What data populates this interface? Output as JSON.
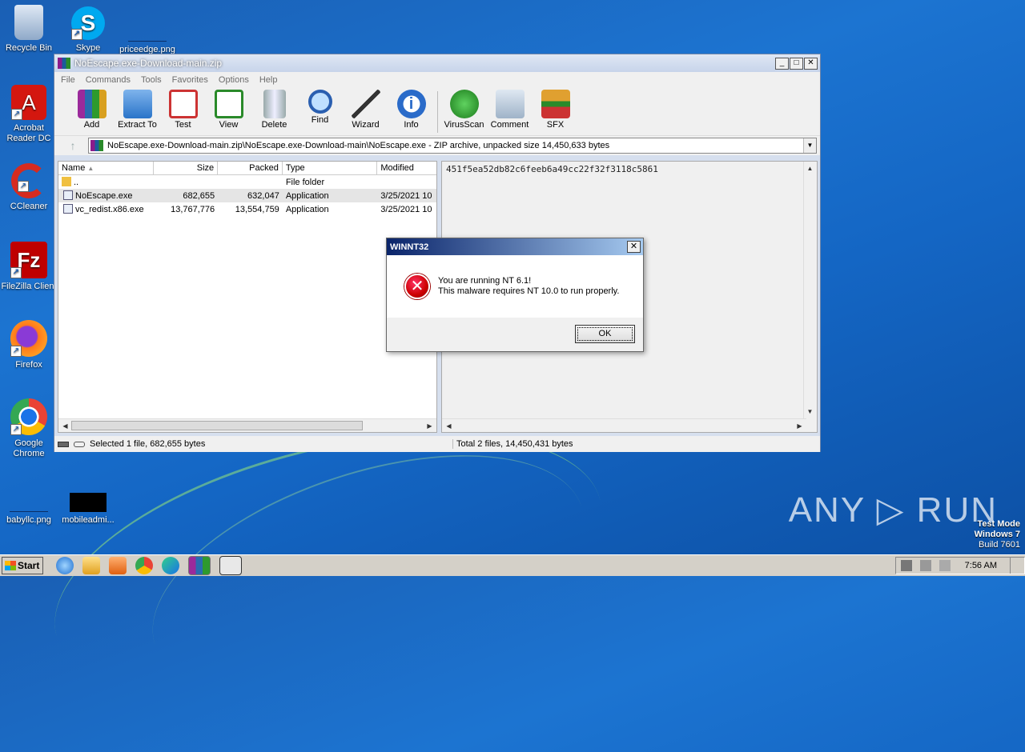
{
  "desktop": {
    "icons": [
      {
        "label": "Recycle Bin"
      },
      {
        "label": "Skype"
      },
      {
        "label": "priceedge.png"
      },
      {
        "label": "Acrobat Reader DC"
      },
      {
        "label": "CCleaner"
      },
      {
        "label": "FileZilla Client"
      },
      {
        "label": "Firefox"
      },
      {
        "label": "Google Chrome"
      },
      {
        "label": "babyllc.png"
      },
      {
        "label": "mobileadmi..."
      }
    ]
  },
  "winrar": {
    "title": "NoEscape.exe-Download-main.zip",
    "menu": [
      "File",
      "Commands",
      "Tools",
      "Favorites",
      "Options",
      "Help"
    ],
    "toolbar": [
      "Add",
      "Extract To",
      "Test",
      "View",
      "Delete",
      "Find",
      "Wizard",
      "Info",
      "VirusScan",
      "Comment",
      "SFX"
    ],
    "address": "NoEscape.exe-Download-main.zip\\NoEscape.exe-Download-main\\NoEscape.exe - ZIP archive, unpacked size 14,450,633 bytes",
    "columns": [
      "Name",
      "Size",
      "Packed",
      "Type",
      "Modified"
    ],
    "rows": [
      {
        "name": "..",
        "size": "",
        "packed": "",
        "type": "File folder",
        "modified": ""
      },
      {
        "name": "NoEscape.exe",
        "size": "682,655",
        "packed": "632,047",
        "type": "Application",
        "modified": "3/25/2021 10"
      },
      {
        "name": "vc_redist.x86.exe",
        "size": "13,767,776",
        "packed": "13,554,759",
        "type": "Application",
        "modified": "3/25/2021 10"
      }
    ],
    "hash": "451f5ea52db82c6feeb6a49cc22f32f3118c5861",
    "status_left": "Selected 1 file, 682,655 bytes",
    "status_right": "Total 2 files, 14,450,431 bytes"
  },
  "dialog": {
    "title": "WINNT32",
    "line1": "You are running NT 6.1!",
    "line2": "This malware requires NT 10.0 to run properly.",
    "ok": "OK"
  },
  "taskbar": {
    "start": "Start",
    "clock": "7:56 AM"
  },
  "watermark": "ANY ▷ RUN",
  "testmode": {
    "line1": "Test Mode",
    "line2": "Windows 7",
    "line3": "Build 7601"
  }
}
